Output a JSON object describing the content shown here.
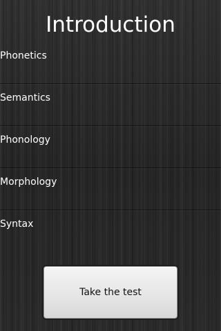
{
  "header": {
    "title": "Introduction"
  },
  "topics": [
    {
      "label": "Phonetics"
    },
    {
      "label": "Semantics"
    },
    {
      "label": "Phonology"
    },
    {
      "label": "Morphology"
    },
    {
      "label": "Syntax"
    }
  ],
  "footer": {
    "button_label": "Take the test"
  }
}
